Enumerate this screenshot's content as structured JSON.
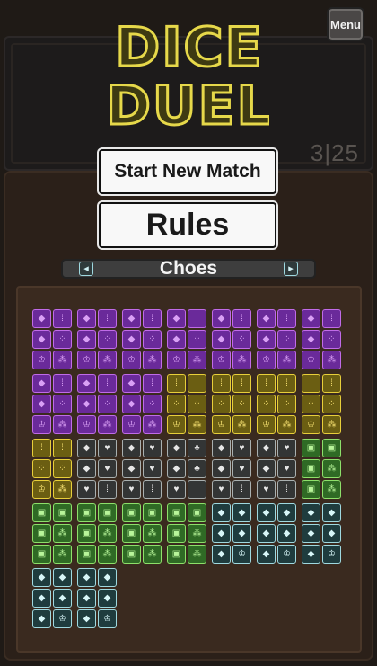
{
  "menu": {
    "label": "Menu"
  },
  "logo": {
    "line1": "DICE",
    "line2": "DUEL"
  },
  "score": {
    "text": "3|25"
  },
  "buttons": {
    "start": "Start New Match",
    "rules": "Rules"
  },
  "selector": {
    "label": "Choes",
    "prev_icon": "arrow-left-icon",
    "next_icon": "arrow-right-icon"
  },
  "colors": {
    "purple": {
      "fill": "#6a2a9a",
      "border": "#c06be8",
      "glyph": "#d9a0f5"
    },
    "yellow": {
      "fill": "#6b5e12",
      "border": "#e8cf3a",
      "glyph": "#f5e070"
    },
    "gray": {
      "fill": "#333535",
      "border": "#a9b0b0",
      "glyph": "#e6e6e6"
    },
    "green": {
      "fill": "#2f6a25",
      "border": "#8de06a",
      "glyph": "#b8f59a"
    },
    "teal": {
      "fill": "#1f3c3e",
      "border": "#9fd9e0",
      "glyph": "#d8f6f8"
    }
  },
  "dice_sets": [
    {
      "color": "purple",
      "faces": [
        "◆",
        "⁞",
        "◆",
        "⁘",
        "♔",
        "⁂"
      ]
    },
    {
      "color": "purple",
      "faces": [
        "◆",
        "⁞",
        "◆",
        "⁘",
        "♔",
        "⁂"
      ]
    },
    {
      "color": "purple",
      "faces": [
        "◆",
        "⁞",
        "◆",
        "⁘",
        "♔",
        "⁂"
      ]
    },
    {
      "color": "purple",
      "faces": [
        "◆",
        "⁞",
        "◆",
        "⁘",
        "♔",
        "⁂"
      ]
    },
    {
      "color": "purple",
      "faces": [
        "◆",
        "⁞",
        "◆",
        "⁘",
        "♔",
        "⁂"
      ]
    },
    {
      "color": "purple",
      "faces": [
        "◆",
        "⁞",
        "◆",
        "⁘",
        "♔",
        "⁂"
      ]
    },
    {
      "color": "purple",
      "faces": [
        "◆",
        "⁞",
        "◆",
        "⁘",
        "♔",
        "⁂"
      ]
    },
    {
      "color": "purple",
      "faces": [
        "◆",
        "⁞",
        "◆",
        "⁘",
        "♔",
        "⁂"
      ]
    },
    {
      "color": "purple",
      "faces": [
        "◆",
        "⁞",
        "◆",
        "⁘",
        "♔",
        "⁂"
      ]
    },
    {
      "color": "purple",
      "faces": [
        "◆",
        "⁞",
        "◆",
        "⁘",
        "♔",
        "⁂"
      ]
    },
    {
      "color": "yellow",
      "faces": [
        "⁞",
        "⁞",
        "⁘",
        "⁘",
        "♔",
        "⁂"
      ]
    },
    {
      "color": "yellow",
      "faces": [
        "⁞",
        "⁞",
        "⁘",
        "⁘",
        "♔",
        "⁂"
      ]
    },
    {
      "color": "yellow",
      "faces": [
        "⁞",
        "⁞",
        "⁘",
        "⁘",
        "♔",
        "⁂"
      ]
    },
    {
      "color": "yellow",
      "faces": [
        "⁞",
        "⁞",
        "⁘",
        "⁘",
        "♔",
        "⁂"
      ]
    },
    {
      "color": "yellow",
      "faces": [
        "⁞",
        "⁞",
        "⁘",
        "⁘",
        "♔",
        "⁂"
      ]
    },
    {
      "color": "gray",
      "faces": [
        "◆",
        "♥",
        "◆",
        "♥",
        "♥",
        "⁞"
      ]
    },
    {
      "color": "gray",
      "faces": [
        "◆",
        "♥",
        "◆",
        "♥",
        "♥",
        "⁞"
      ]
    },
    {
      "color": "gray",
      "faces": [
        "◆",
        "♣",
        "◆",
        "♣",
        "♥",
        "⁞"
      ]
    },
    {
      "color": "gray",
      "faces": [
        "◆",
        "♥",
        "◆",
        "♥",
        "♥",
        "⁞"
      ]
    },
    {
      "color": "gray",
      "faces": [
        "◆",
        "♥",
        "◆",
        "♥",
        "♥",
        "⁞"
      ]
    },
    {
      "color": "green",
      "faces": [
        "▣",
        "▣",
        "▣",
        "⁂",
        "▣",
        "⁂"
      ]
    },
    {
      "color": "green",
      "faces": [
        "▣",
        "▣",
        "▣",
        "⁂",
        "▣",
        "⁂"
      ]
    },
    {
      "color": "green",
      "faces": [
        "▣",
        "▣",
        "▣",
        "⁂",
        "▣",
        "⁂"
      ]
    },
    {
      "color": "green",
      "faces": [
        "▣",
        "▣",
        "▣",
        "⁂",
        "▣",
        "⁂"
      ]
    },
    {
      "color": "green",
      "faces": [
        "▣",
        "▣",
        "▣",
        "⁂",
        "▣",
        "⁂"
      ]
    },
    {
      "color": "teal",
      "faces": [
        "◆",
        "◆",
        "◆",
        "◆",
        "◆",
        "♔"
      ]
    },
    {
      "color": "teal",
      "faces": [
        "◆",
        "◆",
        "◆",
        "◆",
        "◆",
        "♔"
      ]
    },
    {
      "color": "teal",
      "faces": [
        "◆",
        "◆",
        "◆",
        "◆",
        "◆",
        "♔"
      ]
    },
    {
      "color": "teal",
      "faces": [
        "◆",
        "◆",
        "◆",
        "◆",
        "◆",
        "♔"
      ]
    },
    {
      "color": "teal",
      "faces": [
        "◆",
        "◆",
        "◆",
        "◆",
        "◆",
        "♔"
      ]
    }
  ]
}
